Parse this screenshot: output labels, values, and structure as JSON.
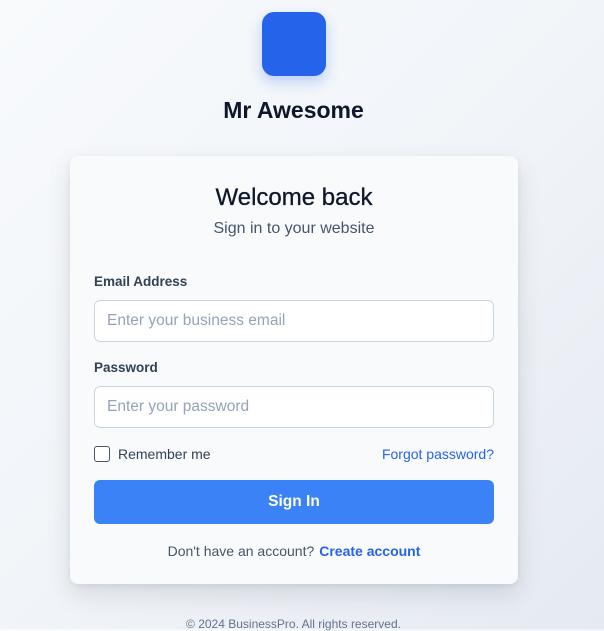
{
  "brand": {
    "name": "Mr Awesome",
    "logo_color": "#2563eb"
  },
  "login_card": {
    "title": "Welcome back",
    "subtitle": "Sign in to your website",
    "email": {
      "label": "Email Address",
      "placeholder": "Enter your business email",
      "value": ""
    },
    "password": {
      "label": "Password",
      "placeholder": "Enter your password",
      "value": ""
    },
    "remember_me": {
      "label": "Remember me",
      "checked": false
    },
    "forgot_password_label": "Forgot password?",
    "submit_label": "Sign In",
    "signup_prompt": "Don't have an account?",
    "signup_link_label": "Create account"
  },
  "footer": {
    "text": "© 2024 BusinessPro. All rights reserved."
  },
  "colors": {
    "primary_button": "#3b82f6",
    "link": "#2563eb",
    "heading": "#0f172a",
    "muted_text": "#475569"
  }
}
